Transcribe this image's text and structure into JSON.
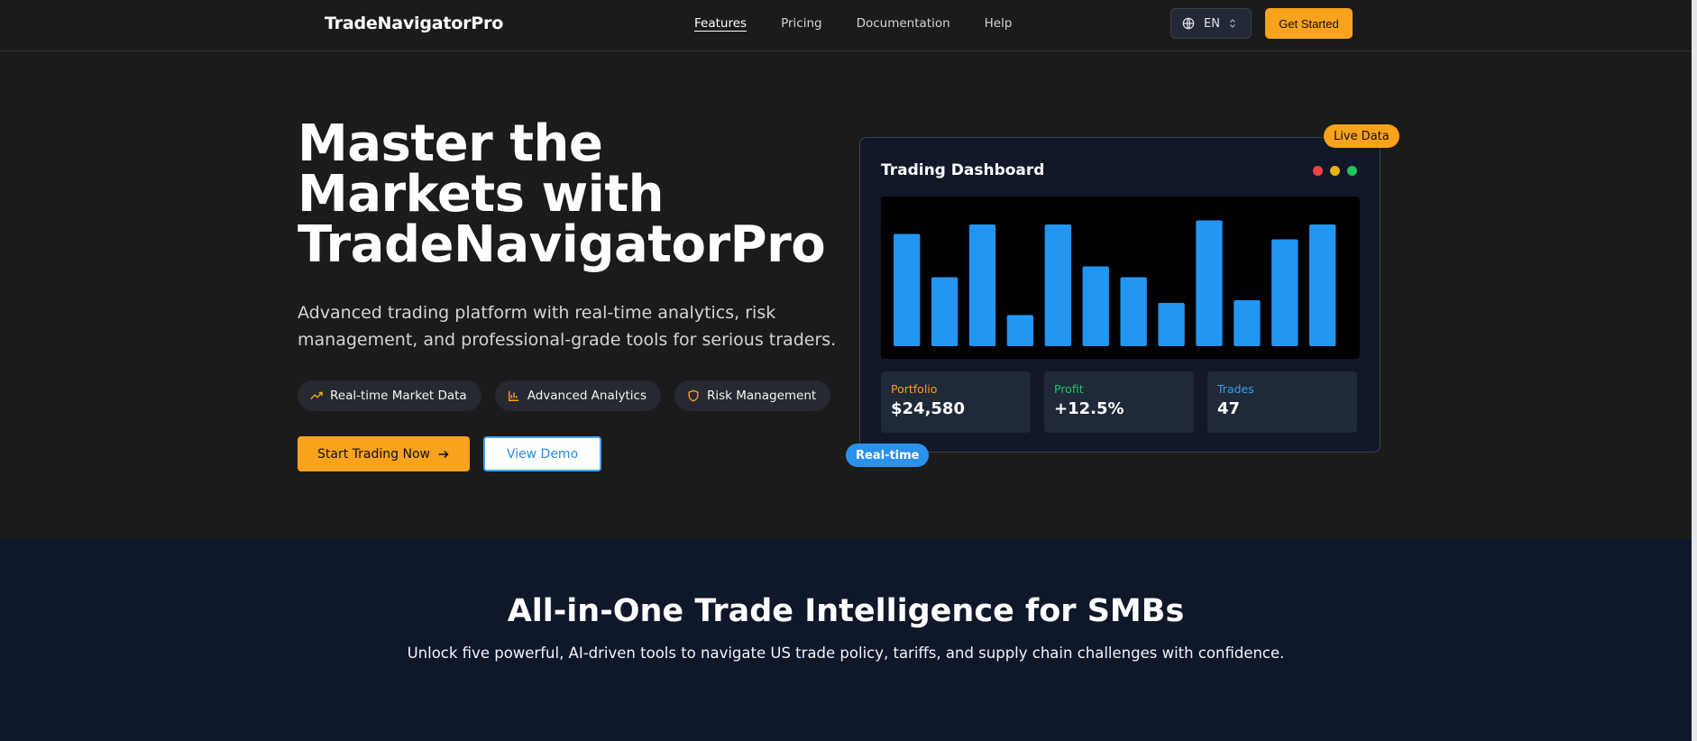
{
  "nav": {
    "brand": "TradeNavigatorPro",
    "links": [
      "Features",
      "Pricing",
      "Documentation",
      "Help"
    ],
    "language": "EN",
    "cta": "Get Started"
  },
  "hero": {
    "title": "Master the Markets with TradeNavigatorPro",
    "subtitle": "Advanced trading platform with real-time analytics, risk management, and professional-grade tools for serious traders.",
    "pills": [
      {
        "label": "Real-time Market Data",
        "icon": "trending-up-icon"
      },
      {
        "label": "Advanced Analytics",
        "icon": "bar-chart-icon"
      },
      {
        "label": "Risk Management",
        "icon": "shield-icon"
      }
    ],
    "primary_button": "Start Trading Now",
    "secondary_button": "View Demo"
  },
  "dashboard": {
    "title": "Trading Dashboard",
    "live_badge": "Live Data",
    "realtime_badge": "Real-time",
    "window_dots": [
      "#ef4444",
      "#eab308",
      "#22c55e"
    ],
    "stats": [
      {
        "label": "Portfolio",
        "value": "$24,580",
        "color": "#f9a21b"
      },
      {
        "label": "Profit",
        "value": "+12.5%",
        "color": "#22c55e"
      },
      {
        "label": "Trades",
        "value": "47",
        "color": "#3b9eed"
      }
    ]
  },
  "chart_data": {
    "type": "bar",
    "values": [
      0.83,
      0.51,
      0.9,
      0.23,
      0.9,
      0.59,
      0.51,
      0.32,
      0.93,
      0.34,
      0.79,
      0.9
    ],
    "ylim": [
      0,
      1
    ],
    "color": "#2196f3"
  },
  "section": {
    "title": "All-in-One Trade Intelligence for SMBs",
    "subtitle": "Unlock five powerful, AI-driven tools to navigate US trade policy, tariffs, and supply chain challenges with confidence."
  },
  "colors": {
    "accent": "#f9a21b",
    "blue": "#2b92ec",
    "background": "#1b1b1c",
    "section_bg": "#0f172a"
  }
}
